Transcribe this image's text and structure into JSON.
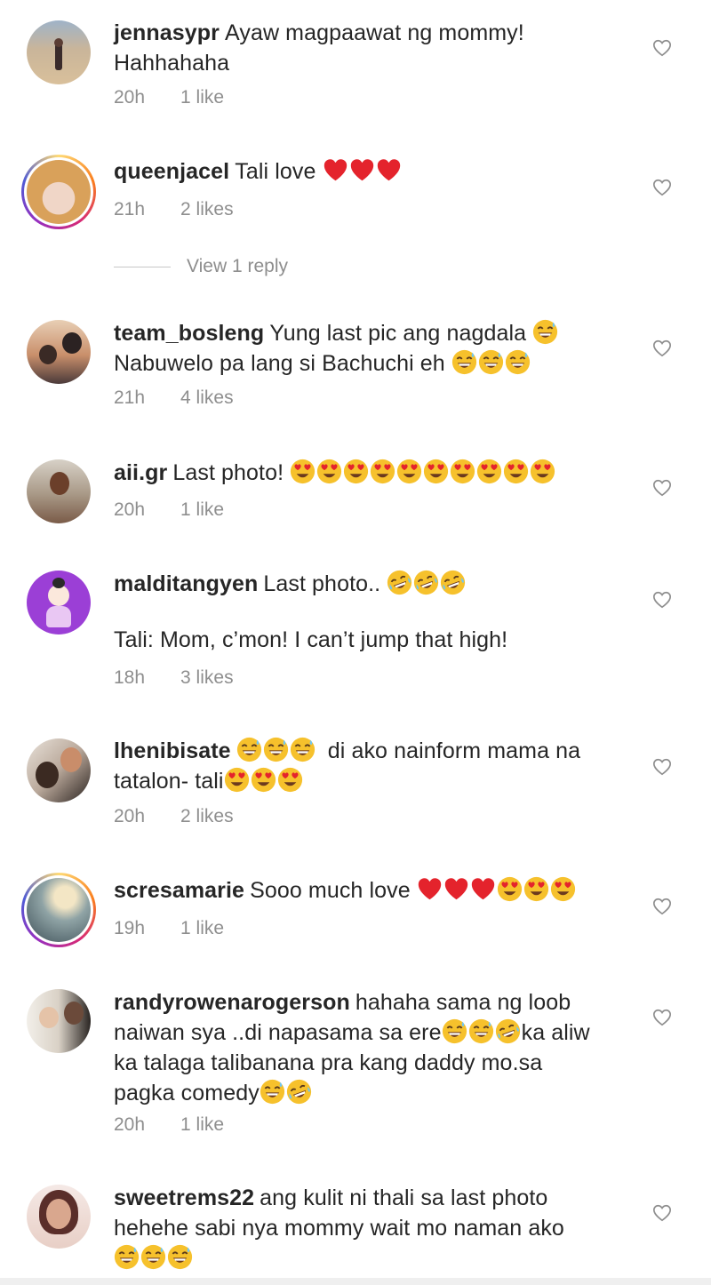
{
  "comments": [
    {
      "user": "jennasypr",
      "line1": "Ayaw magpaawat ng mommy!",
      "line2": "Hahhahaha",
      "time": "20h",
      "likes": "1 like"
    },
    {
      "user": "queenjacel",
      "line1": "Tali love",
      "time": "21h",
      "likes": "2 likes",
      "view_replies": "View 1 reply"
    },
    {
      "user": "team_bosleng",
      "line1": "Yung last pic ang nagdala",
      "line2": "Nabuwelo pa lang si Bachuchi eh",
      "time": "21h",
      "likes": "4 likes"
    },
    {
      "user": "aii.gr",
      "line1": "Last photo!",
      "time": "20h",
      "likes": "1 like"
    },
    {
      "user": "malditangyen",
      "line1": "Last photo..",
      "line2": "Tali: Mom, c’mon! I can’t jump that high!",
      "time": "18h",
      "likes": "3 likes"
    },
    {
      "user": "lhenibisate",
      "line1": "di ako nainform mama na",
      "line2": "tatalon- tali",
      "time": "20h",
      "likes": "2 likes"
    },
    {
      "user": "scresamarie",
      "line1": "Sooo much love",
      "time": "19h",
      "likes": "1 like"
    },
    {
      "user": "randyrowenarogerson",
      "line1": "hahaha sama ng loob",
      "line2": "naiwan sya ..di napasama sa ere",
      "line2b": "ka aliw",
      "line3": "ka talaga talibanana pra kang daddy mo.sa",
      "line4": "pagka comedy",
      "time": "20h",
      "likes": "1 like"
    },
    {
      "user": "sweetrems22",
      "line1": "ang kulit ni thali sa last photo",
      "line2": "hehehe sabi nya mommy wait mo naman ako",
      "time": "",
      "likes": ""
    }
  ],
  "icons": {
    "heart": "heart-outline-icon",
    "emoji_heart": "red-heart",
    "emoji_laugh": "grinning-sweat",
    "emoji_love": "heart-eyes",
    "emoji_rofl": "rolling-laughing"
  },
  "colors": {
    "text": "#262626",
    "meta": "#8e8e8e",
    "heart": "#ed2b2b",
    "emoji": "#f6c12c"
  }
}
